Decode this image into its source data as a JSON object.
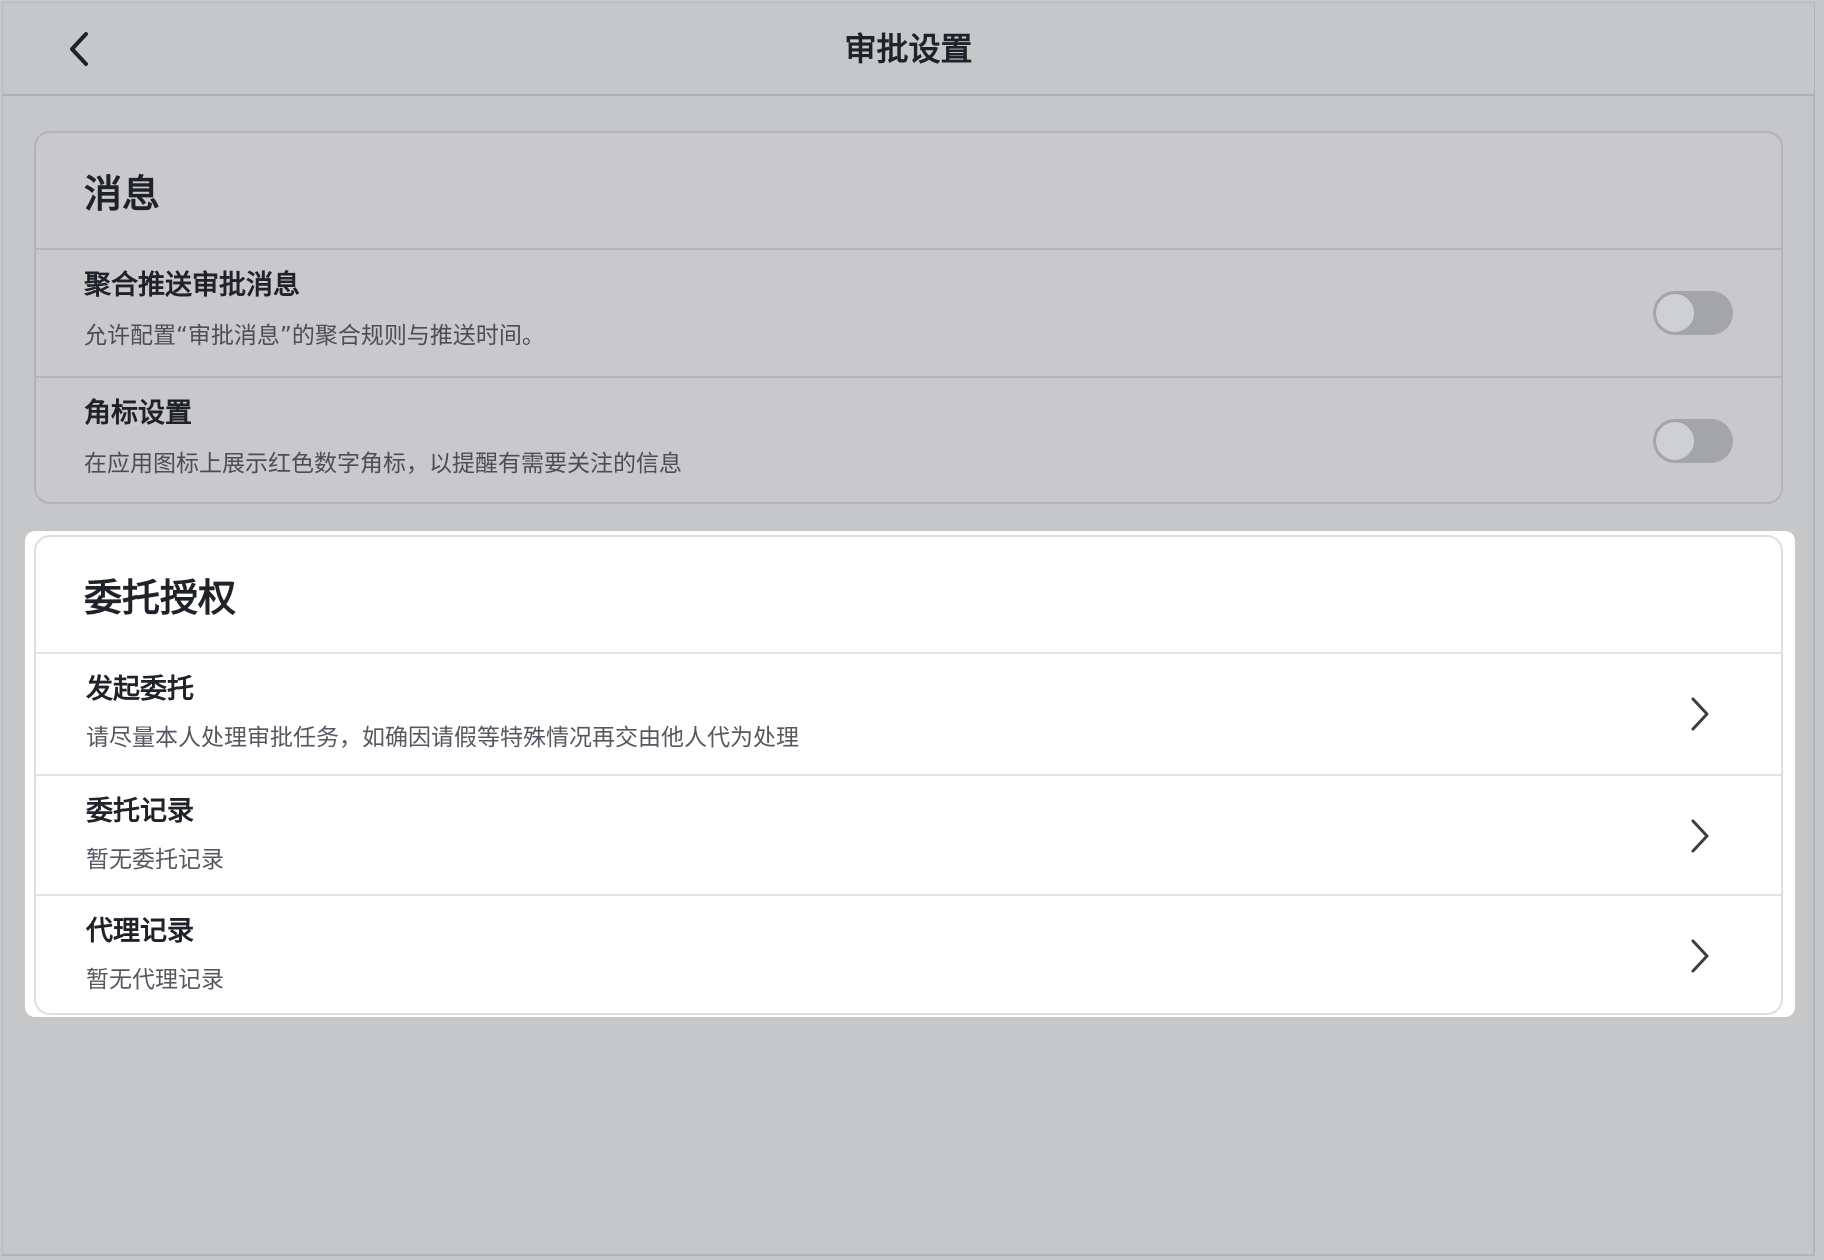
{
  "header": {
    "title": "审批设置",
    "back_icon": "chevron-left-icon"
  },
  "message_section": {
    "title": "消息",
    "items": [
      {
        "title": "聚合推送审批消息",
        "description": "允许配置“审批消息”的聚合规则与推送时间。",
        "toggle_on": false
      },
      {
        "title": "角标设置",
        "description": "在应用图标上展示红色数字角标，以提醒有需要关注的信息",
        "toggle_on": false
      }
    ]
  },
  "delegation_section": {
    "title": "委托授权",
    "items": [
      {
        "title": "发起委托",
        "description": "请尽量本人处理审批任务，如确因请假等特殊情况再交由他人代为处理"
      },
      {
        "title": "委托记录",
        "description": "暂无委托记录"
      },
      {
        "title": "代理记录",
        "description": "暂无代理记录"
      }
    ]
  },
  "colors": {
    "overlay_background": "#c6c7c9",
    "toggle_off": "#a4a5a8",
    "text_primary": "#1f2329",
    "text_secondary": "#4a4e55"
  }
}
